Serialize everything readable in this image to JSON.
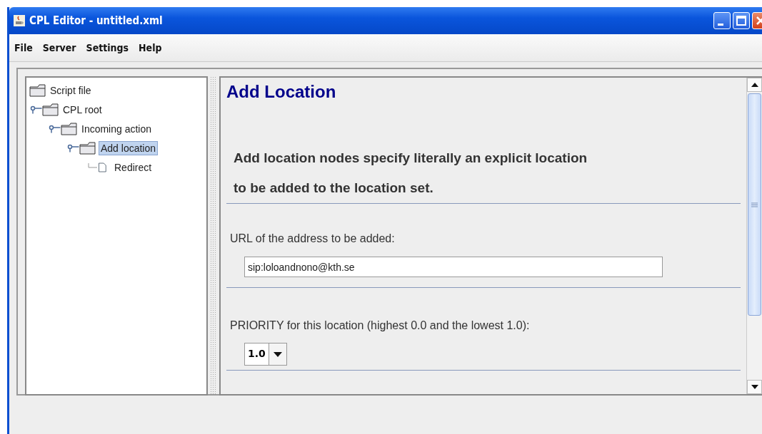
{
  "window": {
    "title": "CPL Editor - untitled.xml"
  },
  "menu": [
    "File",
    "Server",
    "Settings",
    "Help"
  ],
  "tree": [
    {
      "label": "Script file",
      "kind": "folder",
      "selected": false,
      "children": [
        {
          "label": "CPL root",
          "kind": "folder",
          "selected": false,
          "expanded": true,
          "children": [
            {
              "label": "Incoming action",
              "kind": "folder",
              "selected": false,
              "expanded": true,
              "children": [
                {
                  "label": "Add location",
                  "kind": "folder",
                  "selected": true,
                  "expanded": true,
                  "children": [
                    {
                      "label": "Redirect",
                      "kind": "file",
                      "selected": false
                    }
                  ]
                }
              ]
            }
          ]
        }
      ]
    }
  ],
  "panel": {
    "title": "Add Location",
    "description": [
      "Add location nodes specify literally an explicit location",
      "to be added to the location set."
    ],
    "url": {
      "label": "URL of the address to be added:",
      "value": "sip:loloandnono@kth.se"
    },
    "priority": {
      "label": "PRIORITY for this location (highest 0.0 and the lowest 1.0):",
      "value": "1.0"
    }
  }
}
